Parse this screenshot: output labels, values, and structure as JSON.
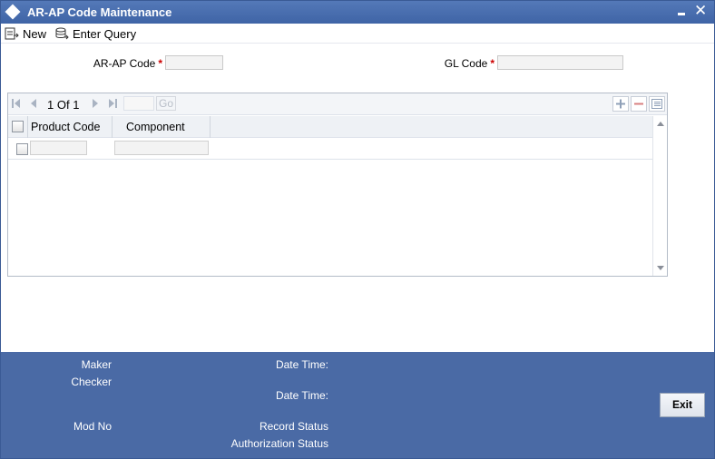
{
  "window": {
    "title": "AR-AP Code Maintenance"
  },
  "toolbar": {
    "new_label": "New",
    "enter_query_label": "Enter Query"
  },
  "form": {
    "arap_code_label": "AR-AP Code",
    "gl_code_label": "GL Code",
    "required_marker": "*",
    "arap_code_value": "",
    "gl_code_value": ""
  },
  "grid": {
    "pager": {
      "current": "1",
      "of_label": "Of",
      "total": "1",
      "go_label": "Go"
    },
    "columns": [
      "Product Code",
      "Component"
    ],
    "rows": [
      {
        "product_code": "",
        "component": ""
      }
    ]
  },
  "footer": {
    "maker_label": "Maker",
    "checker_label": "Checker",
    "mod_no_label": "Mod No",
    "date_time_label_1": "Date Time:",
    "date_time_label_2": "Date Time:",
    "record_status_label": "Record Status",
    "authorization_status_label": "Authorization Status",
    "exit_label": "Exit"
  },
  "colors": {
    "titlebar": "#4a6aa5",
    "footer": "#4a6aa5",
    "required": "#cc0000"
  }
}
